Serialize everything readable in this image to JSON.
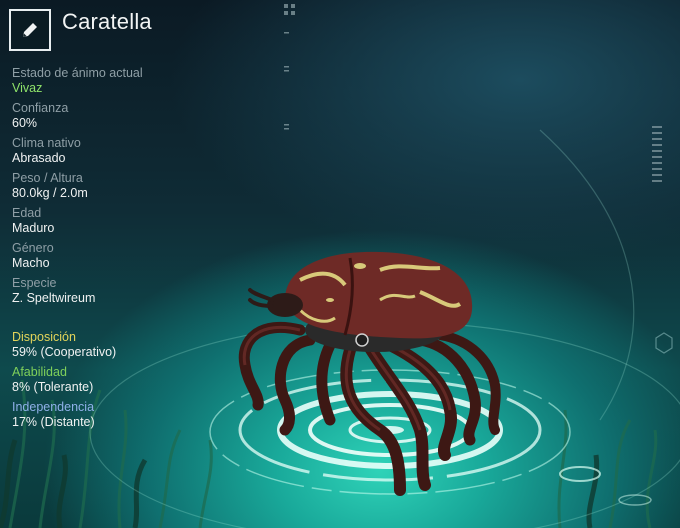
{
  "creature": {
    "name": "Caratella"
  },
  "edit": {
    "icon": "pencil-icon"
  },
  "stats": [
    {
      "label": "Estado de ánimo actual",
      "value": "Vivaz",
      "value_color": "#8fe36a"
    },
    {
      "label": "Confianza",
      "value": "60%"
    },
    {
      "label": "Clima nativo",
      "value": "Abrasado"
    },
    {
      "label": "Peso / Altura",
      "value": "80.0kg / 2.0m"
    },
    {
      "label": "Edad",
      "value": "Maduro"
    },
    {
      "label": "Género",
      "value": "Macho"
    },
    {
      "label": "Especie",
      "value": "Z. Speltwireum"
    }
  ],
  "traits": [
    {
      "label": "Disposición",
      "value": "59% (Cooperativo)",
      "label_color": "#e2d45a"
    },
    {
      "label": "Afabilidad",
      "value": "8% (Tolerante)",
      "label_color": "#7fd05a"
    },
    {
      "label": "Independencia",
      "value": "17% (Distante)",
      "label_color": "#8fb0e8"
    }
  ],
  "colors": {
    "accent_ring": "#c9fff0",
    "shell": "#6e2a26",
    "shell_marking": "#d8c97a"
  }
}
